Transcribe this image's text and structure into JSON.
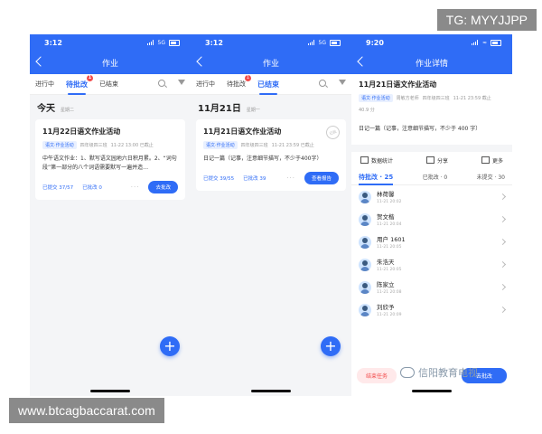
{
  "watermarks": {
    "top_right": "TG: MYYJJPP",
    "bottom_left": "www.btcagbaccarat.com",
    "logo_text": "信阳教育电视"
  },
  "colors": {
    "primary": "#2f6cf6",
    "badge": "#f24b4b"
  },
  "screen1": {
    "time": "3:12",
    "net": "5G",
    "nav_title": "作业",
    "tabs": [
      "进行中",
      "待批改",
      "已结束"
    ],
    "badge": "1",
    "date": "今天",
    "weekday": "星期二",
    "card": {
      "title": "11月22日语文作业活动",
      "tag": "语文·作业活动",
      "class": "四年级四三班",
      "deadline": "11-22 13:00 已截止",
      "content": "中午语文作业：1、默写语文园地六日积月累。2、“词句段”第一部分的八个词语需要默写一遍并造…",
      "submitted": "已提交 37/57",
      "graded": "已批改 0",
      "dots": "···",
      "action": "去批改"
    }
  },
  "screen2": {
    "time": "3:12",
    "net": "5G",
    "nav_title": "作业",
    "tabs": [
      "进行中",
      "待批改",
      "已结束"
    ],
    "badge": "1",
    "date": "11月21日",
    "weekday": "星期一",
    "card": {
      "title": "11月21日语文作业活动",
      "tag": "语文·作业活动",
      "class": "四年级四三班",
      "deadline": "11-21 23:59 已截止",
      "content": "日记一篇（记事，注意细节描写，不少于400字）",
      "submitted": "已提交 39/55",
      "graded": "已批改 39",
      "dots": "···",
      "action": "查看报告",
      "stamp": "已批"
    }
  },
  "screen3": {
    "time": "9:20",
    "nav_title": "作业详情",
    "title": "11月21日语文作业活动",
    "tag": "语文·作业活动",
    "teacher": "周敏方老师",
    "class": "四年级四三班",
    "deadline": "11-21 23:59 截止",
    "score": "40.9 分",
    "content": "日记一篇（记事，注意细节描写，不少于 400 字）",
    "actions": [
      "数据统计",
      "分享",
      "更多"
    ],
    "progress_tabs": [
      "待批改 · 25",
      "已批改 · 0",
      "未提交 · 30"
    ],
    "students": [
      {
        "name": "林荷馨",
        "time": "11-21 20:02"
      },
      {
        "name": "贺文楷",
        "time": "11-21 20:04"
      },
      {
        "name": "用户 1601",
        "time": "11-21 20:05"
      },
      {
        "name": "朱浩天",
        "time": "11-21 20:05"
      },
      {
        "name": "陈家立",
        "time": "11-21 20:08"
      },
      {
        "name": "刘欣予",
        "time": "11-21 20:09"
      }
    ],
    "end_button": "结束任务",
    "grade_button": "去批改"
  }
}
